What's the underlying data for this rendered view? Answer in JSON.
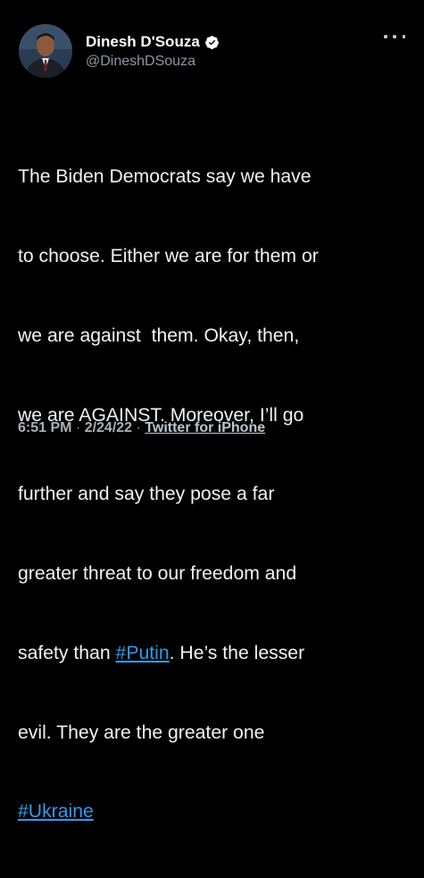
{
  "author": {
    "display_name": "Dinesh D'Souza",
    "handle": "@DineshDSouza",
    "verified": true
  },
  "more_icon": "more-horizontal-icon",
  "tweet": {
    "lines": [
      {
        "text": "The Biden Democrats say we have"
      },
      {
        "text": "to choose. Either we are for them or"
      },
      {
        "text": "we are against  them. Okay, then,"
      },
      {
        "text": "we are AGAINST. Moreover, I’ll go"
      },
      {
        "text": "further and say they pose a far"
      },
      {
        "text": "greater threat to our freedom and"
      },
      {
        "pre": "safety than ",
        "hashtag": "#Putin",
        "post": ". He’s the lesser"
      },
      {
        "text": "evil. They are the greater one"
      },
      {
        "hashtag": "#Ukraine"
      }
    ]
  },
  "meta": {
    "time": "6:51 PM",
    "sep1": " · ",
    "date": "2/24/22",
    "sep2": " · ",
    "source": "Twitter for iPhone"
  },
  "colors": {
    "background": "#000000",
    "text": "#e7e9ea",
    "secondary": "#8b98a5",
    "link": "#2d9cf0",
    "verified_badge": "#ffffff"
  }
}
